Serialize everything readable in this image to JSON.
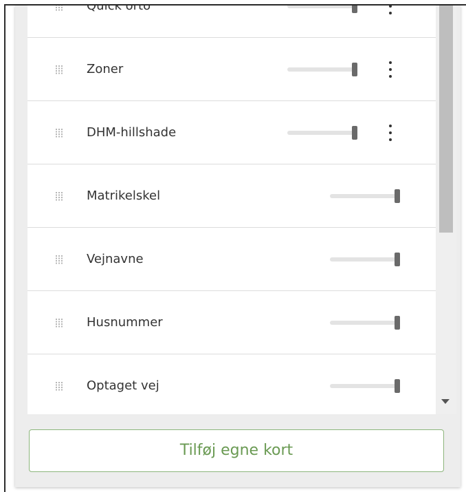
{
  "layers": [
    {
      "label": "Quick orto",
      "opacity": 1.0,
      "has_menu": true
    },
    {
      "label": "Zoner",
      "opacity": 1.0,
      "has_menu": true
    },
    {
      "label": "DHM-hillshade",
      "opacity": 1.0,
      "has_menu": true
    },
    {
      "label": "Matrikelskel",
      "opacity": 1.0,
      "has_menu": false
    },
    {
      "label": "Vejnavne",
      "opacity": 1.0,
      "has_menu": false
    },
    {
      "label": "Husnummer",
      "opacity": 1.0,
      "has_menu": false
    },
    {
      "label": "Optaget vej",
      "opacity": 1.0,
      "has_menu": false
    }
  ],
  "add_button": {
    "label": "Tilføj egne kort"
  },
  "icons": {
    "handle": "drag-handle-icon",
    "menu": "kebab-menu-icon",
    "scroll_down": "scroll-down-arrow-icon"
  },
  "colors": {
    "accent": "#6a9a53",
    "accent_border": "#8cb57b"
  }
}
